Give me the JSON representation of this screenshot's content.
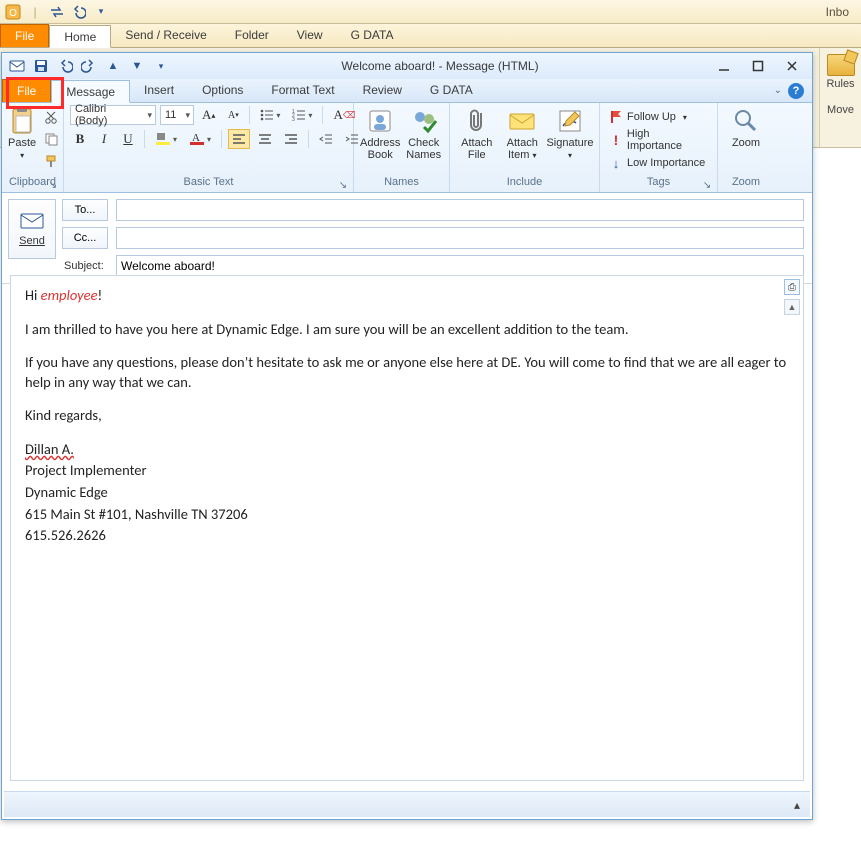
{
  "parent_window": {
    "title_partial": "Inbo",
    "tabs": {
      "file": "File",
      "home": "Home",
      "send_receive": "Send / Receive",
      "folder": "Folder",
      "view": "View",
      "gdata": "G DATA"
    },
    "rules_label": "Rules",
    "move_label": "Move"
  },
  "compose": {
    "title": "Welcome aboard!  -  Message (HTML)",
    "tabs": {
      "file": "File",
      "message": "Message",
      "insert": "Insert",
      "options": "Options",
      "format_text": "Format Text",
      "review": "Review",
      "gdata": "G DATA"
    },
    "ribbon": {
      "clipboard": {
        "label": "Clipboard",
        "paste": "Paste"
      },
      "basic_text": {
        "label": "Basic Text",
        "font_name": "Calibri (Body)",
        "font_size": "11",
        "bold": "B",
        "italic": "I",
        "underline": "U"
      },
      "names": {
        "label": "Names",
        "address_book": "Address Book",
        "check_names": "Check Names"
      },
      "include": {
        "label": "Include",
        "attach_file": "Attach File",
        "attach_item": "Attach Item",
        "signature": "Signature"
      },
      "tags": {
        "label": "Tags",
        "follow_up": "Follow Up",
        "high": "High Importance",
        "low": "Low Importance"
      },
      "zoom": {
        "label": "Zoom",
        "zoom": "Zoom"
      }
    },
    "header": {
      "send": "Send",
      "to_label": "To...",
      "to_value": "",
      "cc_label": "Cc...",
      "cc_value": "",
      "subject_label": "Subject:",
      "subject_value": "Welcome aboard!"
    },
    "body": {
      "greeting_prefix": "Hi ",
      "greeting_var": "employee",
      "greeting_suffix": "!",
      "p1": "I am thrilled to have you here at Dynamic Edge. I am sure you will be an excellent addition to the team.",
      "p2": "If you have any questions, please don’t hesitate to ask me or anyone else here at DE. You will come to find that we are all eager to help in any way that we can.",
      "p3": "Kind regards,",
      "sig_name": "Dillan A.",
      "sig_title": "Project Implementer",
      "sig_company": "Dynamic Edge",
      "sig_address": "615 Main St #101, Nashville TN 37206",
      "sig_phone": "615.526.2626"
    }
  }
}
